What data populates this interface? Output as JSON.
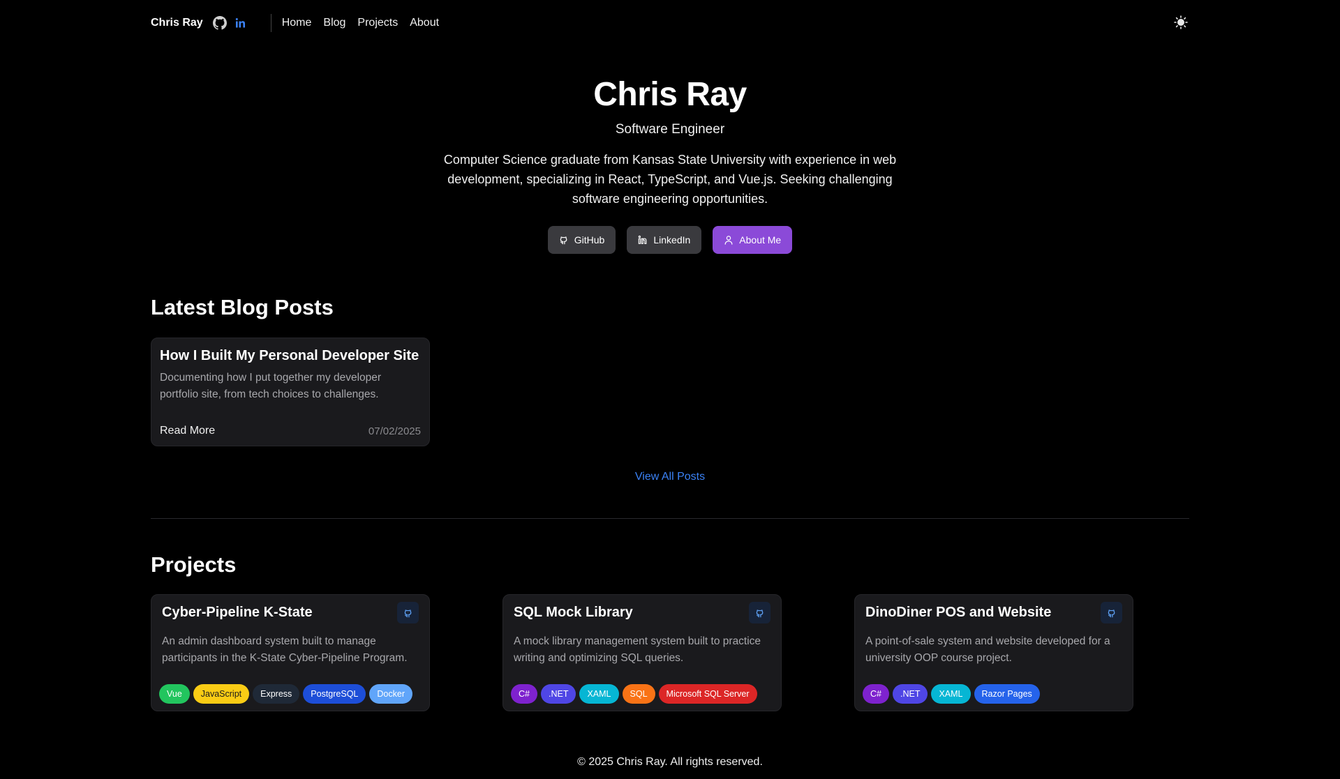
{
  "nav": {
    "brand": "Chris Ray",
    "links": [
      "Home",
      "Blog",
      "Projects",
      "About"
    ],
    "icons": [
      "github-icon",
      "linkedin-icon"
    ],
    "theme_icon": "sun-icon"
  },
  "hero": {
    "name": "Chris Ray",
    "role": "Software Engineer",
    "description": "Computer Science graduate from Kansas State University with experience in web development, specializing in React, TypeScript, and Vue.js. Seeking challenging software engineering opportunities.",
    "buttons": [
      {
        "label": "GitHub",
        "icon": "github-icon"
      },
      {
        "label": "LinkedIn",
        "icon": "linkedin-icon"
      },
      {
        "label": "About Me",
        "icon": "user-icon",
        "color": "#8b4ad8"
      }
    ]
  },
  "blog": {
    "section_title": "Latest Blog Posts",
    "posts": [
      {
        "title": "How I Built My Personal Developer Site",
        "description": "Documenting how I put together my developer portfolio site, from tech choices to challenges.",
        "read_more": "Read More",
        "date": "07/02/2025"
      }
    ],
    "view_all": "View All Posts"
  },
  "projects": {
    "section_title": "Projects",
    "items": [
      {
        "title": "Cyber-Pipeline K-State",
        "description": "An admin dashboard system built to manage participants in the K-State Cyber-Pipeline Program.",
        "tags": [
          {
            "label": "Vue",
            "bg": "#22c55e",
            "fg": "#ffffff"
          },
          {
            "label": "JavaScript",
            "bg": "#facc15",
            "fg": "#1a1a1a"
          },
          {
            "label": "Express",
            "bg": "#1f2937",
            "fg": "#ffffff"
          },
          {
            "label": "PostgreSQL",
            "bg": "#1d4ed8",
            "fg": "#ffffff"
          },
          {
            "label": "Docker",
            "bg": "#60a5fa",
            "fg": "#ffffff"
          }
        ]
      },
      {
        "title": "SQL Mock Library",
        "description": "A mock library management system built to practice writing and optimizing SQL queries.",
        "tags": [
          {
            "label": "C#",
            "bg": "#7e22ce",
            "fg": "#ffffff"
          },
          {
            "label": ".NET",
            "bg": "#4f46e5",
            "fg": "#ffffff"
          },
          {
            "label": "XAML",
            "bg": "#06b6d4",
            "fg": "#ffffff"
          },
          {
            "label": "SQL",
            "bg": "#f97316",
            "fg": "#ffffff"
          },
          {
            "label": "Microsoft SQL Server",
            "bg": "#dc2626",
            "fg": "#ffffff"
          }
        ]
      },
      {
        "title": "DinoDiner POS and Website",
        "description": "A point-of-sale system and website developed for a university OOP course project.",
        "tags": [
          {
            "label": "C#",
            "bg": "#7e22ce",
            "fg": "#ffffff"
          },
          {
            "label": ".NET",
            "bg": "#4f46e5",
            "fg": "#ffffff"
          },
          {
            "label": "XAML",
            "bg": "#06b6d4",
            "fg": "#ffffff"
          },
          {
            "label": "Razor Pages",
            "bg": "#2563eb",
            "fg": "#ffffff"
          }
        ]
      }
    ]
  },
  "footer": {
    "text": "© 2025 Chris Ray. All rights reserved."
  }
}
